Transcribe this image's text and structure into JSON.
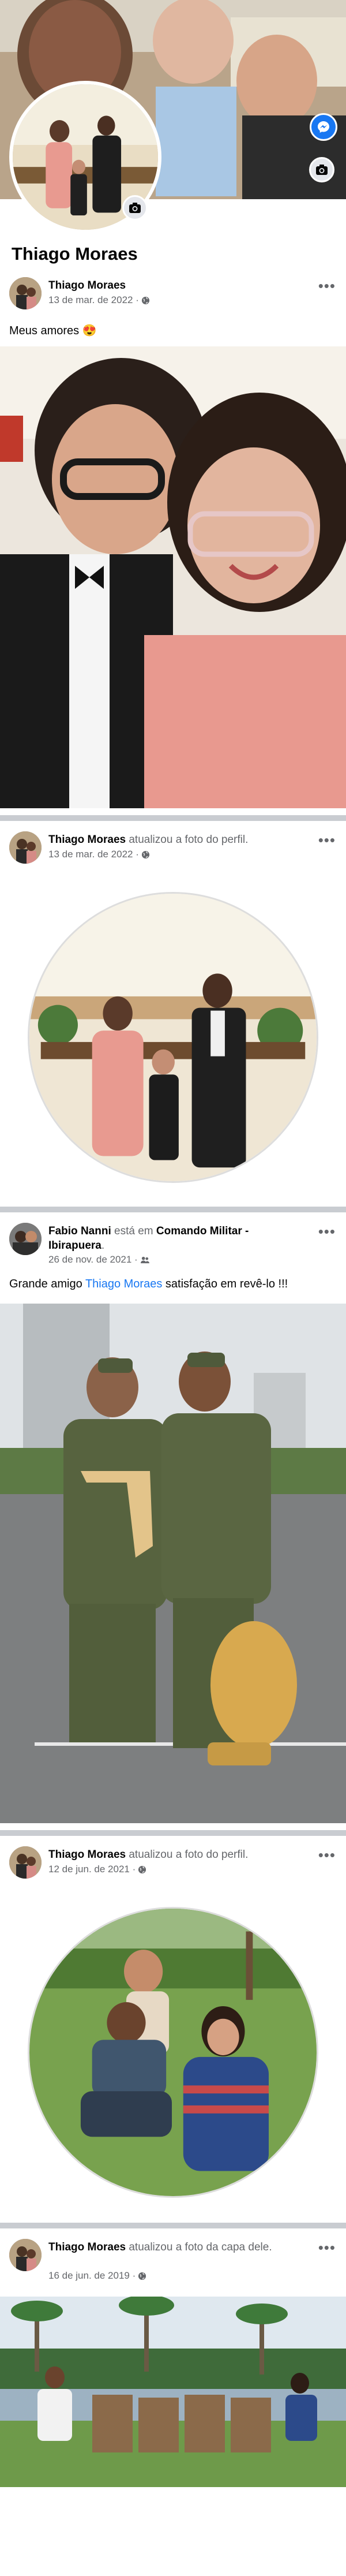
{
  "profile": {
    "name": "Thiago Moraes"
  },
  "icons": {
    "camera": "camera-icon",
    "messenger": "messenger-icon",
    "more": "more-icon",
    "globe": "globe-icon",
    "friends": "friends-icon"
  },
  "posts": [
    {
      "author": "Thiago Moraes",
      "action": "",
      "date": "13 de mar. de 2022 · ",
      "caption": "Meus amores 😍"
    },
    {
      "author": "Thiago Moraes",
      "action": " atualizou a foto do perfil.",
      "date": "13 de mar. de 2022 · "
    },
    {
      "author": "Fabio Nanni",
      "action_prefix": " está em ",
      "place": "Comando Militar - Ibirapuera",
      "action_suffix": ".",
      "date": "26 de nov. de 2021 · ",
      "caption_prefix": "Grande amigo ",
      "caption_link": "Thiago Moraes",
      "caption_suffix": "  satisfação em revê-lo !!!"
    },
    {
      "author": "Thiago Moraes",
      "action": " atualizou a foto do perfil.",
      "date": "12 de jun. de 2021 · "
    },
    {
      "author": "Thiago Moraes",
      "action": " atualizou a foto da capa dele.",
      "date": "16 de jun. de 2019 · "
    }
  ],
  "colors": {
    "accent": "#1877f2",
    "separator": "#c9ccd1",
    "secondary": "#65676b"
  }
}
